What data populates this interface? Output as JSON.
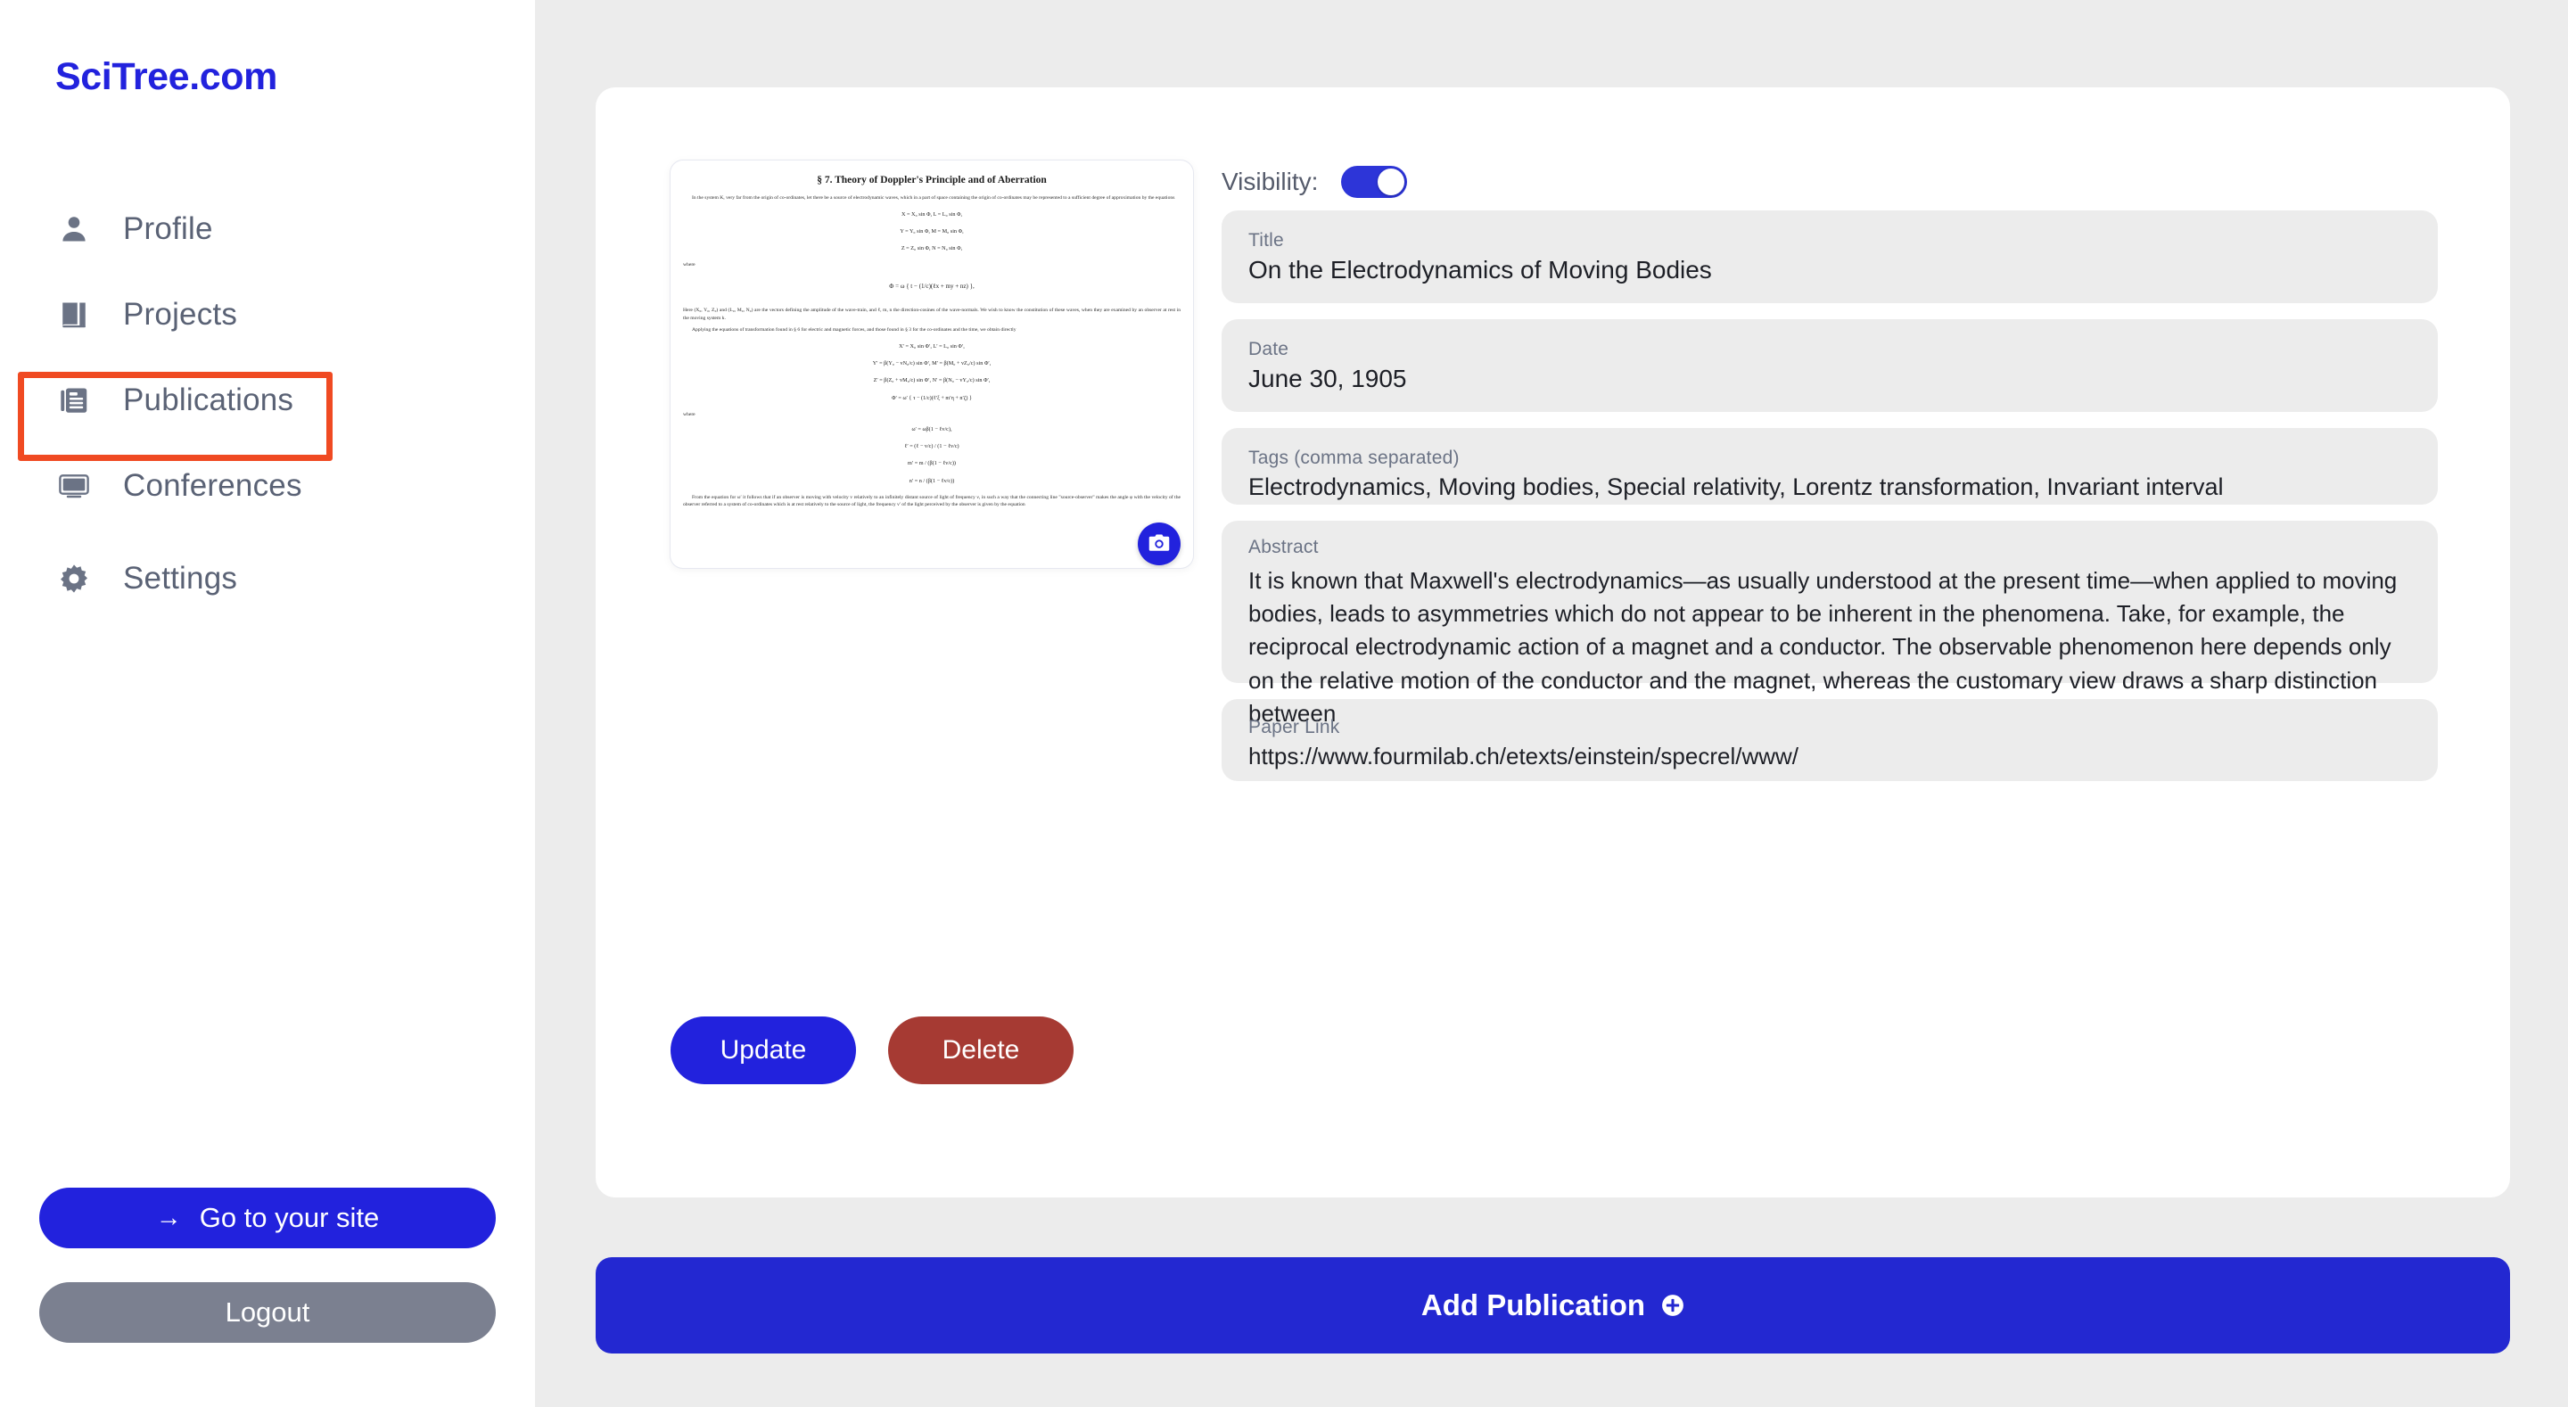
{
  "brand": {
    "name": "SciTree.com"
  },
  "sidebar": {
    "items": [
      {
        "label": "Profile",
        "icon": "person-icon"
      },
      {
        "label": "Projects",
        "icon": "book-icon"
      },
      {
        "label": "Publications",
        "icon": "document-icon",
        "highlighted": true
      },
      {
        "label": "Conferences",
        "icon": "monitor-icon"
      },
      {
        "label": "Settings",
        "icon": "gear-icon"
      }
    ],
    "go_to_site_label": "Go to your site",
    "go_to_site_arrow": "→",
    "logout_label": "Logout"
  },
  "publication": {
    "visibility_label": "Visibility:",
    "visibility_on": true,
    "thumbnail": {
      "alt": "scanned-paper-page",
      "section_title": "§ 7. Theory of Doppler's Principle and of Aberration",
      "paragraphs": [
        "In the system K, very far from the origin of co-ordinates, let there be a source of electrodynamic waves, which in a part of space containing the origin of co-ordinates may be represented to a sufficient degree of approximation by the equations",
        "Here (X₀, Y₀, Z₀) and (L₀, M₀, N₀) are the vectors defining the amplitude of the wave-train, and ℓ, m, n the direction-cosines of the wave-normals. We wish to know the constitution of these waves, when they are examined by an observer at rest in the moving system k.",
        "Applying the equations of transformation found in § 6 for electric and magnetic forces, and those found in § 3 for the co-ordinates and the time, we obtain directly",
        "From the equation for ω′ it follows that if an observer is moving with velocity v relatively to an infinitely distant source of light of frequency ν, in such a way that the connecting line \"source-observer\" makes the angle φ with the velocity of the observer referred to a system of co-ordinates which is at rest relatively to the source of light, the frequency ν′ of the light perceived by the observer is given by the equation"
      ],
      "where_label": "where",
      "equations": [
        "X = X₀ sin Φ,   L = L₀ sin Φ,",
        "Y = Y₀ sin Φ,   M = M₀ sin Φ,",
        "Z = Z₀ sin Φ,   N = N₀ sin Φ,",
        "Φ = ω { t − (1/c)(ℓx + my + nz) },",
        "X′ = X₀ sin Φ′,            L′ = L₀ sin Φ′,",
        "Y′ = β(Y₀ − vN₀/c) sin Φ′,   M′ = β(M₀ + vZ₀/c) sin Φ′,",
        "Z′ = β(Z₀ + vM₀/c) sin Φ′,   N′ = β(N₀ − vY₀/c) sin Φ′,",
        "Φ′ = ω′ { τ − (1/c)(ℓ′ξ + m′η + n′ζ) }",
        "ω′ = ωβ(1 − ℓv/c),",
        "ℓ′ = (ℓ − v/c) / (1 − ℓv/c)",
        "m′ = m / (β(1 − ℓv/c))",
        "n′ = n / (β(1 − ℓv/c))"
      ],
      "camera_button_icon": "camera-icon"
    },
    "fields": [
      {
        "key": "title",
        "label": "Title",
        "value": "On the Electrodynamics of Moving Bodies"
      },
      {
        "key": "date",
        "label": "Date",
        "value": "June 30, 1905"
      },
      {
        "key": "tags",
        "label": "Tags (comma separated)",
        "value": "Electrodynamics, Moving bodies, Special relativity, Lorentz transformation, Invariant interval"
      },
      {
        "key": "abstract",
        "label": "Abstract",
        "value": "It is known that Maxwell's electrodynamics—as usually understood at the present time—when applied to moving bodies, leads to asymmetries which do not appear to be inherent in the phenomena. Take, for example, the reciprocal electrodynamic action of a magnet and a conductor. The observable phenomenon here depends only on the relative motion of the conductor and the magnet, whereas the customary view draws a sharp distinction between"
      },
      {
        "key": "link",
        "label": "Paper Link",
        "value": "https://www.fourmilab.ch/etexts/einstein/specrel/www/"
      }
    ],
    "update_label": "Update",
    "delete_label": "Delete"
  },
  "footer": {
    "add_publication_label": "Add Publication",
    "add_publication_icon": "plus-circle-icon"
  },
  "colors": {
    "brand_blue": "#2222dd",
    "accent_blue": "#2328d1",
    "danger_red": "#a63a33",
    "logout_gray": "#7b8090",
    "field_gray": "#ececec",
    "highlight_orange": "#f04a22"
  }
}
